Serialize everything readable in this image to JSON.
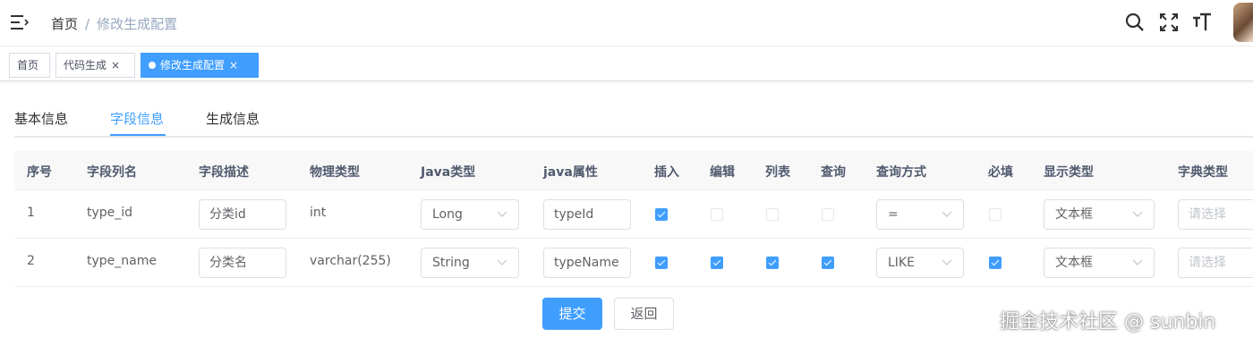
{
  "navbar": {
    "breadcrumb": {
      "home": "首页",
      "separator": "/",
      "current": "修改生成配置"
    },
    "icons": [
      "menu-icon",
      "search-icon",
      "fullscreen-icon",
      "text-size-icon"
    ]
  },
  "tags": [
    {
      "label": "首页",
      "active": false
    },
    {
      "label": "代码生成",
      "active": false,
      "closable": true
    },
    {
      "label": "修改生成配置",
      "active": true,
      "closable": true
    }
  ],
  "tags_close_glyph": "×",
  "tabs": {
    "basic": "基本信息",
    "columns": "字段信息",
    "generate": "生成信息"
  },
  "table": {
    "headers": {
      "seq": "序号",
      "column_name": "字段列名",
      "column_comment": "字段描述",
      "column_type": "物理类型",
      "java_type": "Java类型",
      "java_field": "java属性",
      "insert": "插入",
      "edit": "编辑",
      "list": "列表",
      "query": "查询",
      "query_type": "查询方式",
      "required": "必填",
      "html_type": "显示类型",
      "dict_type": "字典类型"
    },
    "rows": [
      {
        "seq": "1",
        "column_name": "type_id",
        "column_comment": "分类id",
        "column_type": "int",
        "java_type": "Long",
        "java_field": "typeId",
        "insert": true,
        "edit": false,
        "list": false,
        "query": false,
        "query_type": "=",
        "required": false,
        "html_type": "文本框",
        "dict_type_placeholder": "请选择"
      },
      {
        "seq": "2",
        "column_name": "type_name",
        "column_comment": "分类名",
        "column_type": "varchar(255)",
        "java_type": "String",
        "java_field": "typeName",
        "insert": true,
        "edit": true,
        "list": true,
        "query": true,
        "query_type": "LIKE",
        "required": true,
        "html_type": "文本框",
        "dict_type_placeholder": "请选择"
      }
    ]
  },
  "buttons": {
    "submit": "提交",
    "back": "返回"
  },
  "watermark": "掘金技术社区 @ sunbin",
  "colors": {
    "primary": "#409eff",
    "header_bg": "#f8f8f9",
    "border": "#dcdfe6"
  }
}
